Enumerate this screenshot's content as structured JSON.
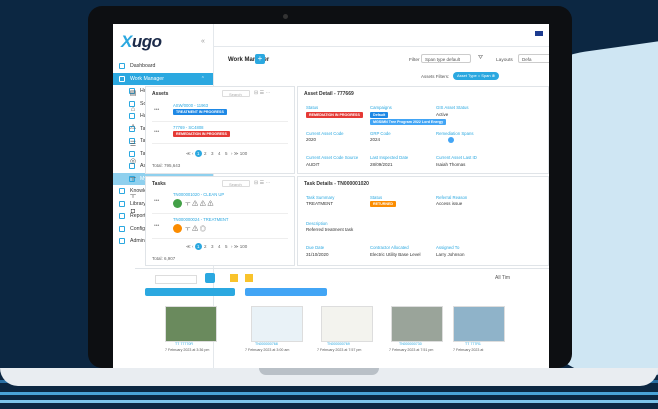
{
  "app": {
    "logo": "ugo",
    "logo_x": "X"
  },
  "sidebar": {
    "items": [
      {
        "label": "Dashboard",
        "active": false
      },
      {
        "label": "Work Manager",
        "active": true,
        "chevron": "⌃"
      },
      {
        "label": "Home",
        "sub": true
      },
      {
        "label": "Schedule",
        "sub": true
      },
      {
        "label": "Hazards",
        "sub": true
      },
      {
        "label": "Tasks",
        "sub": true
      },
      {
        "label": "Tablet - Task & Map",
        "sub": true
      },
      {
        "label": "Task & Map",
        "sub": true
      },
      {
        "label": "Asset Task & Map",
        "sub": true
      },
      {
        "label": "My Layouts",
        "sub": true,
        "subActive": true,
        "chevron": "›"
      },
      {
        "label": "Knowledge Base"
      },
      {
        "label": "Library",
        "chevron": "›"
      },
      {
        "label": "Reporting",
        "chevron": "›"
      },
      {
        "label": "Configuration",
        "chevron": "›"
      },
      {
        "label": "Administration",
        "chevron": "›"
      }
    ]
  },
  "header": {
    "title": "Work Manager",
    "add": "+",
    "filter_label": "Filter",
    "filter_value": "Span type default",
    "layouts_label": "Layouts",
    "layouts_value": "Defa",
    "asset_filters_label": "Assets Filters:",
    "asset_filter_chip": "Asset Type = Span ⊗"
  },
  "assets": {
    "title": "Assets",
    "search": "Search",
    "rows": [
      {
        "id": "ASW/0000 - 11963",
        "chip": "TREATMENT IN PROGRESS",
        "color": "#1e88e5"
      },
      {
        "id": "77769 - SC4808",
        "chip": "REMEDIATION IN PROGRESS",
        "color": "#e53935"
      }
    ],
    "pages": [
      "1",
      "2",
      "3",
      "4",
      "5"
    ],
    "page_size": "100",
    "total": "Total: 795,643"
  },
  "tasks": {
    "title": "Tasks",
    "search": "Search",
    "rows": [
      {
        "id": "TN000001020 - CLEAN UP"
      },
      {
        "id": "TN000000024 - TREATMENT"
      }
    ],
    "pages": [
      "1",
      "2",
      "3",
      "4",
      "5"
    ],
    "page_size": "100",
    "total": "Total: 6,907"
  },
  "asset_detail": {
    "title": "Asset Detail - 777669",
    "fields": [
      {
        "label": "Status",
        "value": "REMEDIATION IN PROGRESS",
        "chip": true
      },
      {
        "label": "Campaigns",
        "value": "Default"
      },
      {
        "label": "GIS Asset Status",
        "value": "Active"
      },
      {
        "label": "Current Asset Code",
        "value": "2020"
      },
      {
        "label": "GRP Code",
        "value": "2024"
      },
      {
        "label": "Remediation Spans",
        "value": ""
      },
      {
        "label": "Current Asset Code Source",
        "value": "AUDIT"
      },
      {
        "label": "Last Inspected Date",
        "value": "28/09/2021"
      },
      {
        "label": "Current Asset Last ID",
        "value": "Isaiah Thomas"
      }
    ],
    "campaign_chip": "MGS/MN Tree Program 2022 Lord Energy"
  },
  "task_detail": {
    "title": "Task Details - TN000001020",
    "fields": [
      {
        "label": "Task Summary",
        "value": "TREATMENT"
      },
      {
        "label": "Status",
        "value": "RETURNED"
      },
      {
        "label": "Referral Reason",
        "value": "Access issue"
      },
      {
        "label": "Description",
        "value": "Referred treatment task"
      },
      {
        "label": "Due Date",
        "value": "31/10/2020"
      },
      {
        "label": "Contractor Allocated",
        "value": "Electric Utility Base Level"
      },
      {
        "label": "Assigned To",
        "value": "Larry Johnson"
      }
    ]
  },
  "gallery": {
    "thumbs": [
      {
        "cap": "TT 77770R",
        "date": "7 February 2023 at 3:36 pm"
      },
      {
        "cap": "TN000000768",
        "date": "7 February 2023 at 3:00 am"
      },
      {
        "cap": "TN000000769",
        "date": "7 February 2023 at 7:57 pm"
      },
      {
        "cap": "TN000000730",
        "date": "7 February 2023 at 7:51 pm"
      },
      {
        "cap": "TT 777R1",
        "date": "7 February 2023 at"
      }
    ],
    "all_label": "All Tim"
  }
}
